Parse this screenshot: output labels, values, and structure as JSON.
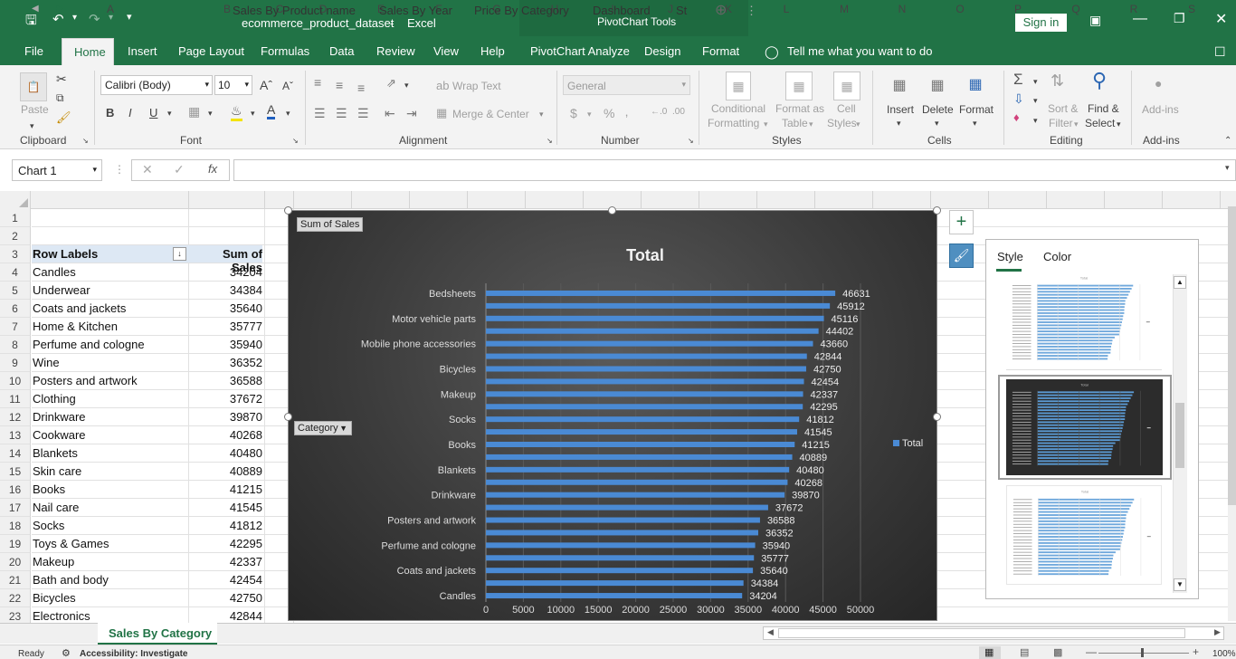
{
  "title": {
    "file": "ecommerce_product_dataset",
    "app": "Excel",
    "context_tools": "PivotChart Tools",
    "sign_in": "Sign in"
  },
  "ribbon_tabs": [
    "File",
    "Home",
    "Insert",
    "Page Layout",
    "Formulas",
    "Data",
    "Review",
    "View",
    "Help",
    "PivotChart Analyze",
    "Design",
    "Format"
  ],
  "tell_me": "Tell me what you want to do",
  "ribbon": {
    "clipboard": {
      "paste": "Paste",
      "group": "Clipboard"
    },
    "font": {
      "name": "Calibri (Body)",
      "size": "10",
      "bold": "B",
      "italic": "I",
      "underline": "U",
      "group": "Font"
    },
    "alignment": {
      "wrap": "Wrap Text",
      "merge": "Merge & Center",
      "group": "Alignment"
    },
    "number": {
      "format": "General",
      "currency": "$",
      "percent": "%",
      "comma": "‚",
      "inc": "←.0",
      "dec": ".00",
      "group": "Number"
    },
    "styles": {
      "conditional": "Conditional",
      "formatting": "Formatting",
      "format_as": "Format as",
      "table": "Table",
      "cell": "Cell",
      "cell_styles": "Styles",
      "group": "Styles"
    },
    "cells": {
      "insert": "Insert",
      "delete": "Delete",
      "format": "Format",
      "group": "Cells"
    },
    "editing": {
      "sort": "Sort &",
      "filter": "Filter",
      "find": "Find &",
      "select": "Select",
      "group": "Editing"
    },
    "addins": {
      "label": "Add-ins",
      "group": "Add-ins"
    }
  },
  "namebox": "Chart 1",
  "fx": "fx",
  "columns": [
    "A",
    "B",
    "C",
    "D",
    "E",
    "F",
    "G",
    "H",
    "I",
    "J",
    "K",
    "L",
    "M",
    "N",
    "O",
    "P",
    "Q",
    "R",
    "S"
  ],
  "row_numbers": [
    "1",
    "2",
    "3",
    "4",
    "5",
    "6",
    "7",
    "8",
    "9",
    "10",
    "11",
    "12",
    "13",
    "14",
    "15",
    "16",
    "17",
    "18",
    "19",
    "20",
    "21",
    "22",
    "23"
  ],
  "pivot_header": {
    "labels": "Row Labels",
    "sum": "Sum of Sales"
  },
  "pivot_rows": [
    [
      "Candles",
      "34204"
    ],
    [
      "Underwear",
      "34384"
    ],
    [
      "Coats and jackets",
      "35640"
    ],
    [
      "Home & Kitchen",
      "35777"
    ],
    [
      "Perfume and cologne",
      "35940"
    ],
    [
      "Wine",
      "36352"
    ],
    [
      "Posters and artwork",
      "36588"
    ],
    [
      "Clothing",
      "37672"
    ],
    [
      "Drinkware",
      "39870"
    ],
    [
      "Cookware",
      "40268"
    ],
    [
      "Blankets",
      "40480"
    ],
    [
      "Skin care",
      "40889"
    ],
    [
      "Books",
      "41215"
    ],
    [
      "Nail care",
      "41545"
    ],
    [
      "Socks",
      "41812"
    ],
    [
      "Toys & Games",
      "42295"
    ],
    [
      "Makeup",
      "42337"
    ],
    [
      "Bath and body",
      "42454"
    ],
    [
      "Bicycles",
      "42750"
    ],
    [
      "Electronics",
      "42844"
    ]
  ],
  "chart": {
    "field_button": "Sum of Sales",
    "axis_button": "Category",
    "legend": "Total",
    "accent": "#4a8ad4"
  },
  "chart_data": {
    "type": "bar",
    "title": "Total",
    "categories_labeled": [
      "Bedsheets",
      "Motor vehicle parts",
      "Mobile phone accessories",
      "Bicycles",
      "Makeup",
      "Socks",
      "Books",
      "Blankets",
      "Drinkware",
      "Posters and artwork",
      "Perfume and cologne",
      "Coats and jackets",
      "Candles"
    ],
    "values": [
      46631,
      45912,
      45116,
      44402,
      43660,
      42844,
      42750,
      42454,
      42337,
      42295,
      41812,
      41545,
      41215,
      40889,
      40480,
      40268,
      39870,
      37672,
      36588,
      36352,
      35940,
      35777,
      35640,
      34384,
      34204
    ],
    "xticks": [
      "0",
      "5000",
      "10000",
      "15000",
      "20000",
      "25000",
      "30000",
      "35000",
      "40000",
      "45000",
      "50000"
    ],
    "xlim": [
      0,
      50000
    ],
    "series": [
      {
        "name": "Total"
      }
    ],
    "legend_position": "right"
  },
  "style_panel": {
    "tab_style": "Style",
    "tab_color": "Color"
  },
  "sheet_tabs": [
    "Sales By Category",
    "Sales By Product name",
    "Sales By Year",
    "Price By Category",
    "Dashboard",
    "St"
  ],
  "status": {
    "ready": "Ready",
    "accessibility": "Accessibility: Investigate",
    "zoom": "100%"
  }
}
